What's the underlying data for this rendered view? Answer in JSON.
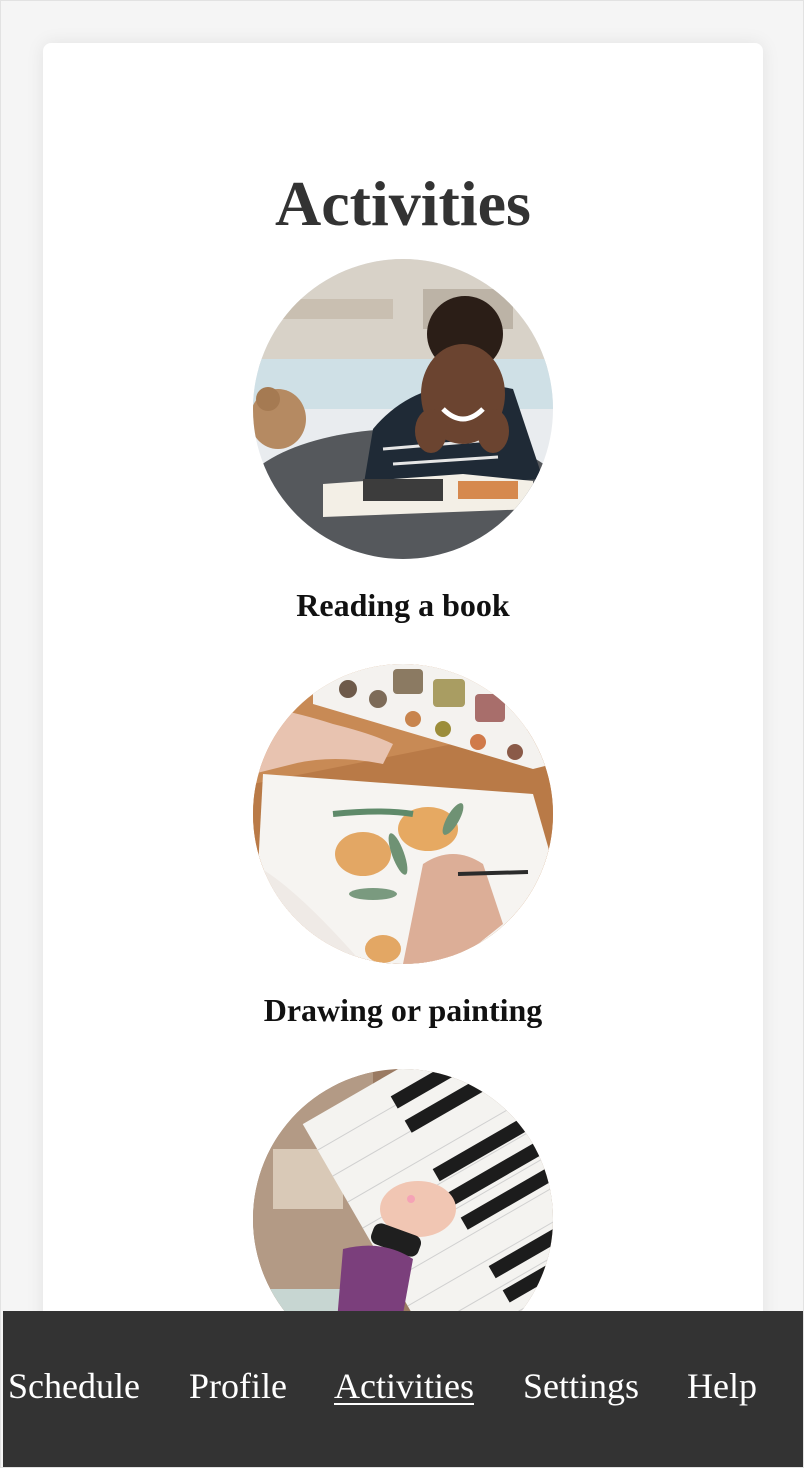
{
  "page": {
    "title": "Activities"
  },
  "activities": [
    {
      "label": "Reading a book",
      "image": "child-reading-photo"
    },
    {
      "label": "Drawing or painting",
      "image": "watercolor-painting-photo"
    },
    {
      "label": "",
      "image": "child-playing-piano-photo"
    }
  ],
  "nav": {
    "items": [
      "Schedule",
      "Profile",
      "Activities",
      "Settings",
      "Help"
    ],
    "active": "Activities"
  },
  "colors": {
    "nav_background": "#333333",
    "page_background": "#f5f5f5",
    "card_background": "#ffffff",
    "title_color": "#333333"
  }
}
